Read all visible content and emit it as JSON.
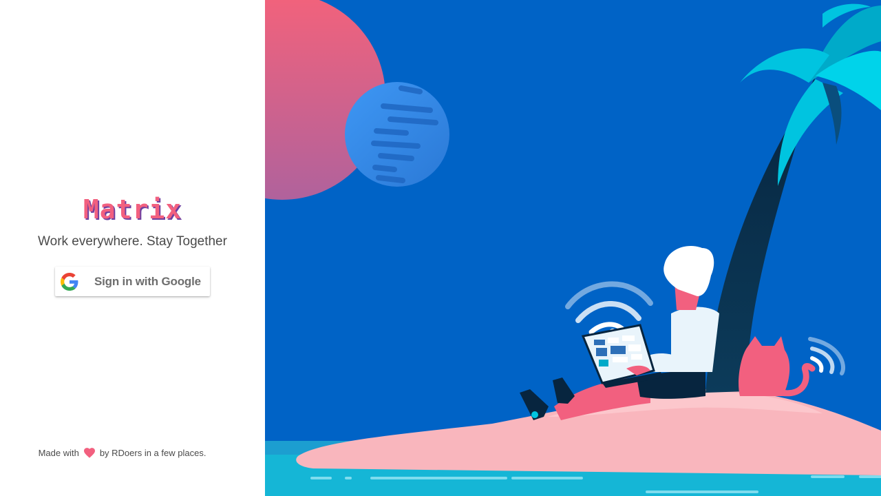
{
  "app": {
    "title": "Matrix",
    "tagline": "Work everywhere. Stay Together"
  },
  "auth": {
    "google_button_label": "Sign in with Google",
    "google_icon": "google-g-icon"
  },
  "footer": {
    "prefix": "Made with",
    "heart_icon": "heart-icon",
    "suffix": "by RDoers in a few places."
  },
  "colors": {
    "brand_pink": "#f2607f",
    "brand_shadow": "#6c3fa0",
    "illustration_bg": "#0063c6",
    "sand": "#f9b6bd",
    "palm_leaf": "#00c4e0"
  },
  "illustration": {
    "subject": "person-working-on-laptop-on-island",
    "elements": [
      "sun",
      "moon",
      "palm-tree",
      "person",
      "laptop",
      "cat",
      "wifi-signal",
      "ocean",
      "island"
    ]
  }
}
